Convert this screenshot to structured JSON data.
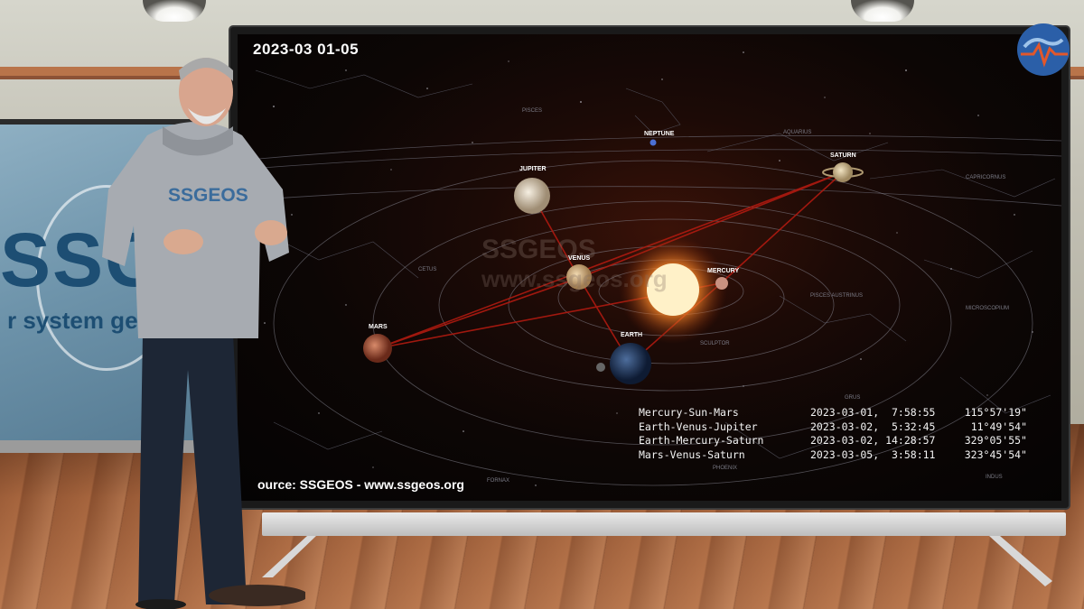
{
  "overlay": {
    "date_range": "2023-03  01-05",
    "source": "ource: SSGEOS - www.ssgeos.org",
    "watermark_line1": "SSGEOS",
    "watermark_line2": "www.ssgeos.org"
  },
  "planets": {
    "neptune": "NEPTUNE",
    "saturn": "SATURN",
    "jupiter": "JUPITER",
    "venus": "VENUS",
    "mercury": "MERCURY",
    "mars": "MARS",
    "earth": "EARTH"
  },
  "constellations": {
    "pisces": "PISCES",
    "aquarius": "AQUARIUS",
    "capricornus": "CAPRICORNUS",
    "cetus": "CETUS",
    "pisces_austrinus": "PISCES AUSTRINUS",
    "microscopium": "MICROSCOPIUM",
    "sculptor": "SCULPTOR",
    "grus": "GRUS",
    "fornax": "FORNAX",
    "phoenix": "PHOENIX",
    "indus": "INDUS"
  },
  "events": [
    {
      "name": "Mercury-Sun-Mars",
      "datetime": "2023-03-01,  7:58:55",
      "angle": "115°57'19\""
    },
    {
      "name": "Earth-Venus-Jupiter",
      "datetime": "2023-03-02,  5:32:45",
      "angle": "11°49'54\""
    },
    {
      "name": "Earth-Mercury-Saturn",
      "datetime": "2023-03-02, 14:28:57",
      "angle": "329°05'55\""
    },
    {
      "name": "Mars-Venus-Saturn",
      "datetime": "2023-03-05,  3:58:11",
      "angle": "323°45'54\""
    }
  ],
  "background_screen": {
    "logo": "SSGE",
    "subtitle": "r system geom"
  },
  "hoodie": {
    "logo": "SSGEOS"
  },
  "colors": {
    "alignment_line": "#b01a10",
    "sun": "#ffd27a",
    "brand_blue": "#1d4e73"
  }
}
